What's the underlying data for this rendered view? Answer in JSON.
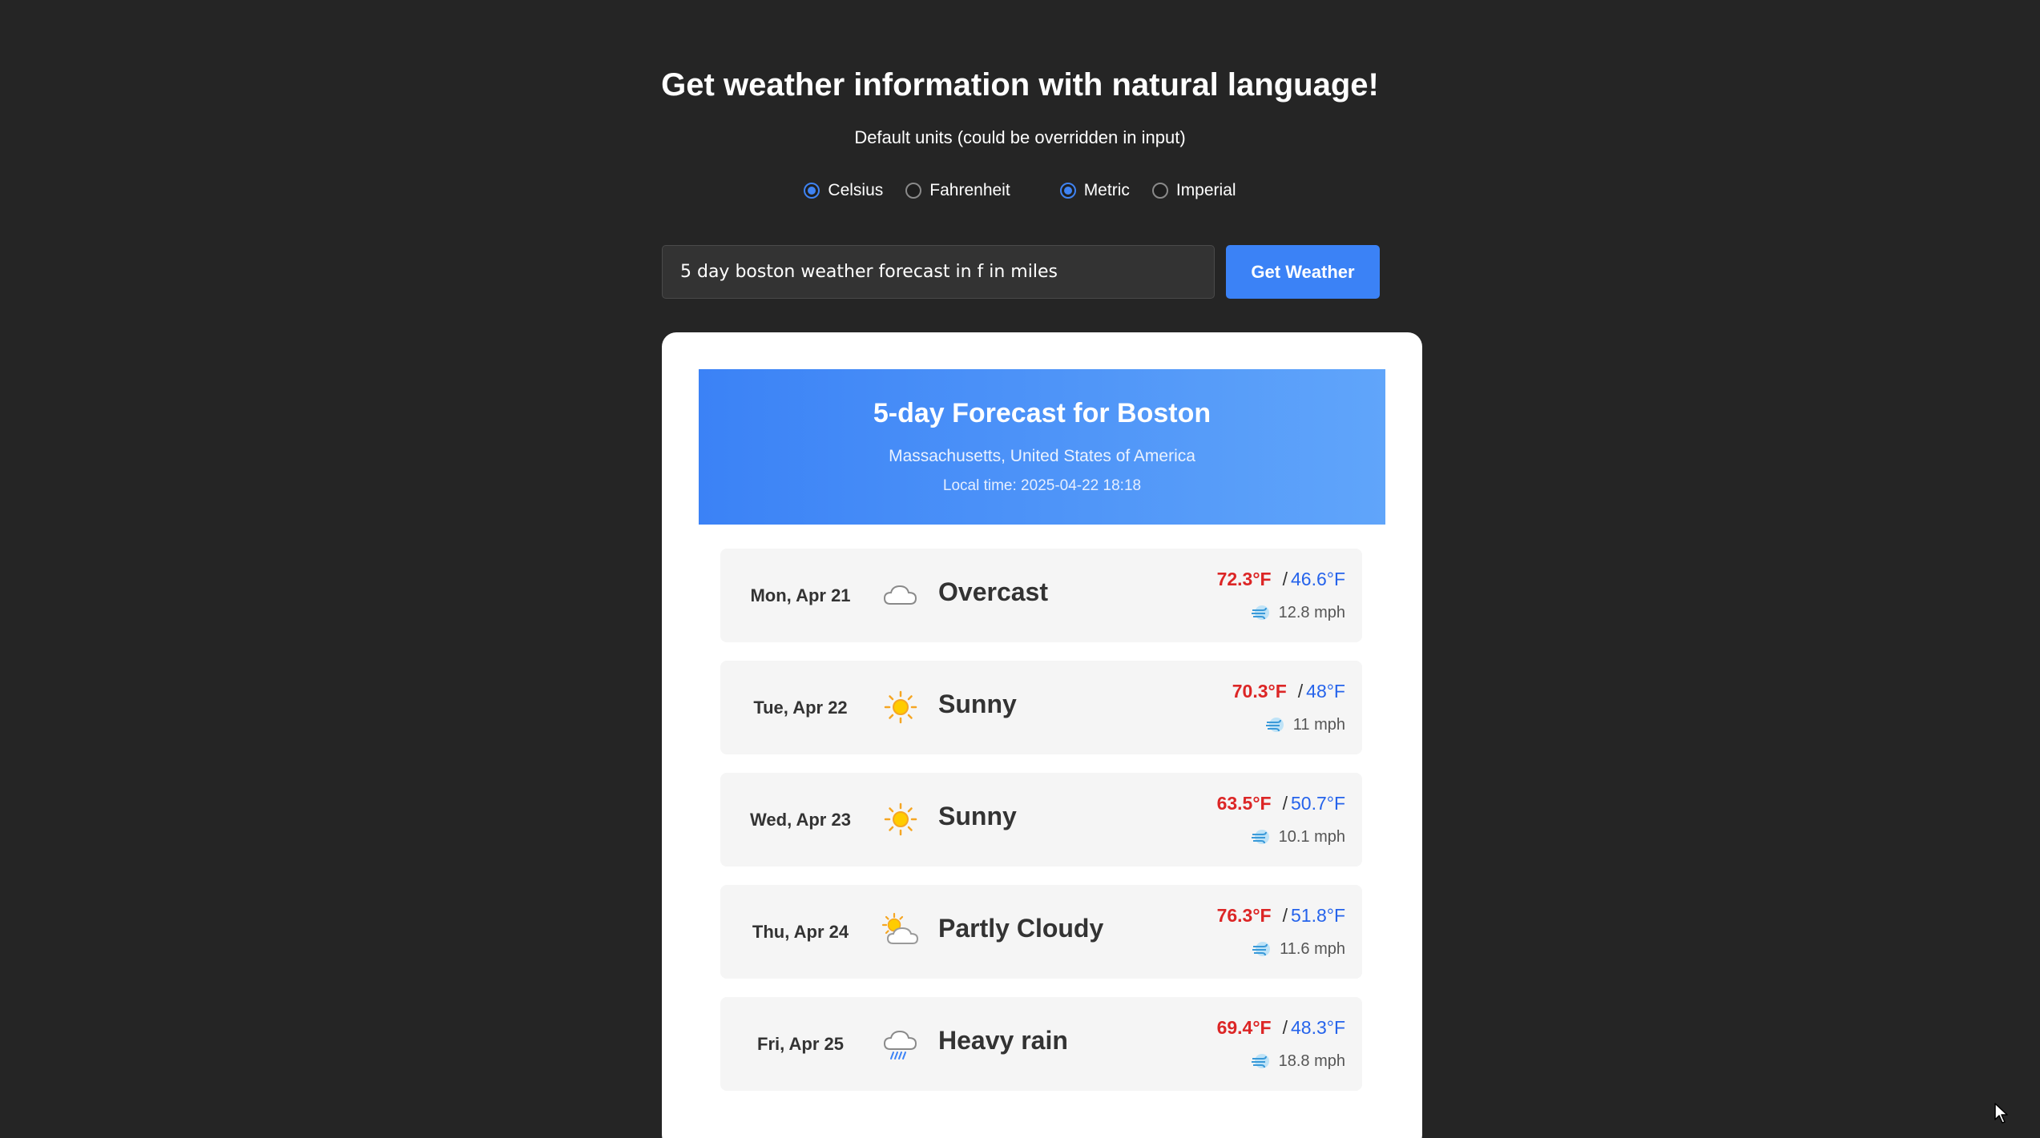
{
  "header": {
    "title": "Get weather information with natural language!",
    "subtitle": "Default units (could be overridden in input)"
  },
  "units": {
    "temperature": [
      {
        "label": "Celsius",
        "selected": true
      },
      {
        "label": "Fahrenheit",
        "selected": false
      }
    ],
    "measurement": [
      {
        "label": "Metric",
        "selected": true
      },
      {
        "label": "Imperial",
        "selected": false
      }
    ]
  },
  "search": {
    "value": "5 day boston weather forecast in f in miles",
    "button_label": "Get Weather"
  },
  "forecast": {
    "title": "5-day Forecast for Boston",
    "region": "Massachusetts, United States of America",
    "local_time": "Local time: 2025-04-22 18:18",
    "days": [
      {
        "date": "Mon, Apr 21",
        "icon": "overcast-icon",
        "condition": "Overcast",
        "high": "72.3°F",
        "low": "46.6°F",
        "wind": "12.8 mph"
      },
      {
        "date": "Tue, Apr 22",
        "icon": "sunny-icon",
        "condition": "Sunny",
        "high": "70.3°F",
        "low": "48°F",
        "wind": "11 mph"
      },
      {
        "date": "Wed, Apr 23",
        "icon": "sunny-icon",
        "condition": "Sunny",
        "high": "63.5°F",
        "low": "50.7°F",
        "wind": "10.1 mph"
      },
      {
        "date": "Thu, Apr 24",
        "icon": "partly-cloudy-icon",
        "condition": "Partly Cloudy",
        "high": "76.3°F",
        "low": "51.8°F",
        "wind": "11.6 mph"
      },
      {
        "date": "Fri, Apr 25",
        "icon": "heavy-rain-icon",
        "condition": "Heavy rain",
        "high": "69.4°F",
        "low": "48.3°F",
        "wind": "18.8 mph"
      }
    ]
  },
  "colors": {
    "background": "#252525",
    "accent": "#3b82f6",
    "high_temp": "#dc2626",
    "low_temp": "#2563eb"
  }
}
